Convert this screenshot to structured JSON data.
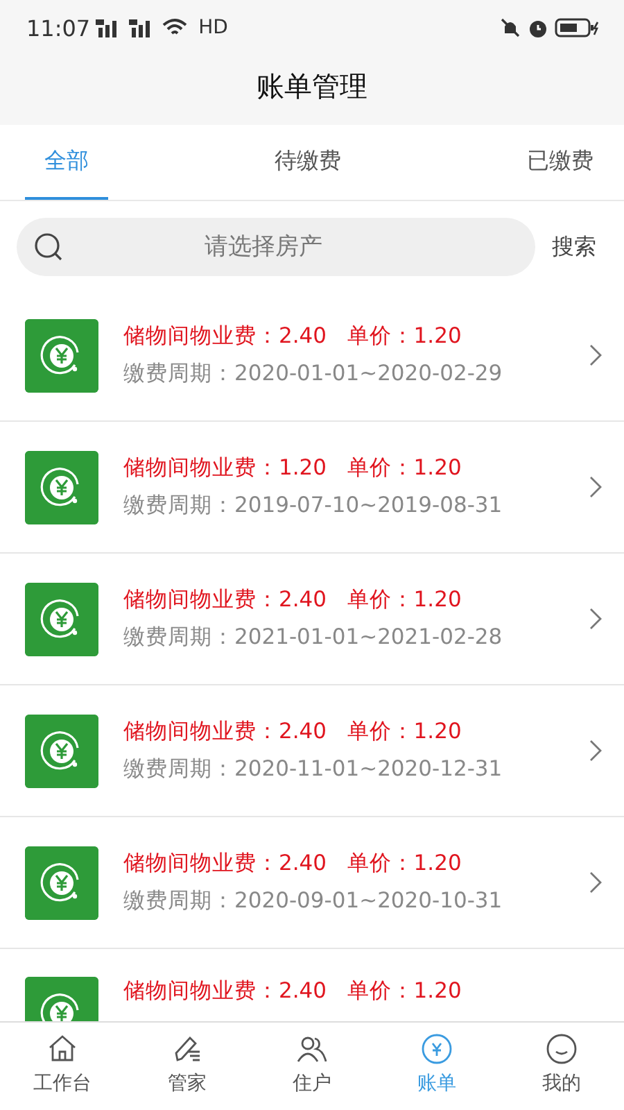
{
  "status_bar": {
    "time": "11:07",
    "network": "HD"
  },
  "title": "账单管理",
  "tabs": [
    {
      "label": "全部",
      "selected": true
    },
    {
      "label": "待缴费",
      "selected": false
    },
    {
      "label": "已缴费",
      "selected": false
    }
  ],
  "search": {
    "placeholder": "请选择房产",
    "button": "搜索"
  },
  "bills": [
    {
      "title": "储物间物业费：2.40   单价：1.20",
      "period": "缴费周期：2020-01-01~2020-02-29"
    },
    {
      "title": "储物间物业费：1.20   单价：1.20",
      "period": "缴费周期：2019-07-10~2019-08-31"
    },
    {
      "title": "储物间物业费：2.40   单价：1.20",
      "period": "缴费周期：2021-01-01~2021-02-28"
    },
    {
      "title": "储物间物业费：2.40   单价：1.20",
      "period": "缴费周期：2020-11-01~2020-12-31"
    },
    {
      "title": "储物间物业费：2.40   单价：1.20",
      "period": "缴费周期：2020-09-01~2020-10-31"
    },
    {
      "title": "储物间物业费：2.40   单价：1.20"
    }
  ],
  "nav": [
    {
      "kind": "home",
      "label": "工作台",
      "selected": false
    },
    {
      "kind": "pen",
      "label": "管家",
      "selected": false
    },
    {
      "kind": "people",
      "label": "住户",
      "selected": false
    },
    {
      "kind": "bill",
      "label": "账单",
      "selected": true
    },
    {
      "kind": "face",
      "label": "我的",
      "selected": false
    }
  ]
}
